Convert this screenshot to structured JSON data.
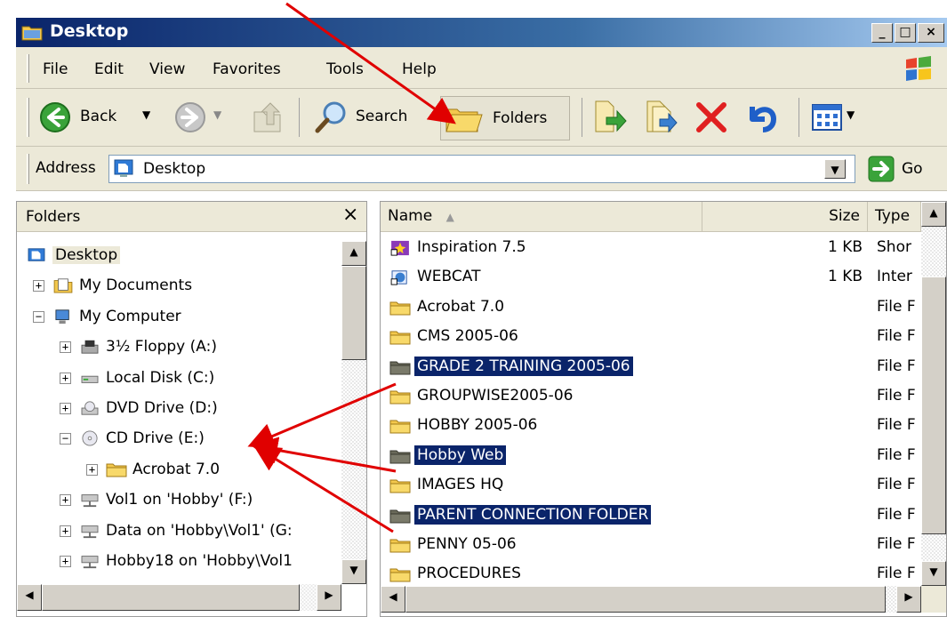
{
  "window": {
    "title": "Desktop"
  },
  "caption_buttons": {
    "minimize": "_",
    "maximize": "□",
    "close": "×"
  },
  "menu": [
    "File",
    "Edit",
    "View",
    "Favorites",
    "Tools",
    "Help"
  ],
  "toolbar": {
    "back_label": "Back",
    "search_label": "Search",
    "folders_label": "Folders"
  },
  "address": {
    "label": "Address",
    "value": "Desktop",
    "go_label": "Go"
  },
  "folders_pane": {
    "title": "Folders",
    "close_label": "×",
    "items": [
      {
        "label": "Desktop",
        "icon": "desktop-icon",
        "expander": ""
      },
      {
        "label": "My Documents",
        "icon": "my-documents-icon",
        "expander": "+"
      },
      {
        "label": "My Computer",
        "icon": "my-computer-icon",
        "expander": "−"
      },
      {
        "label": "3½ Floppy (A:)",
        "icon": "floppy-icon",
        "expander": "+"
      },
      {
        "label": "Local Disk (C:)",
        "icon": "hard-disk-icon",
        "expander": "+"
      },
      {
        "label": "DVD Drive (D:)",
        "icon": "dvd-drive-icon",
        "expander": "+"
      },
      {
        "label": "CD Drive (E:)",
        "icon": "cd-drive-icon",
        "expander": "−"
      },
      {
        "label": "Acrobat 7.0",
        "icon": "folder-icon",
        "expander": "+"
      },
      {
        "label": "Vol1 on 'Hobby' (F:)",
        "icon": "network-drive-icon",
        "expander": "+"
      },
      {
        "label": "Data on 'Hobby\\Vol1' (G:",
        "icon": "network-drive-icon",
        "expander": "+"
      },
      {
        "label": "Hobby18 on 'Hobby\\Vol1",
        "icon": "network-drive-icon",
        "expander": "+"
      }
    ]
  },
  "file_list": {
    "columns": [
      "Name",
      "Size",
      "Type"
    ],
    "rows": [
      {
        "name": "Inspiration 7.5",
        "size": "1 KB",
        "type": "Shor",
        "icon": "shortcut-app-icon",
        "selected": false
      },
      {
        "name": "WEBCAT",
        "size": "1 KB",
        "type": "Inter",
        "icon": "internet-shortcut-icon",
        "selected": false
      },
      {
        "name": "Acrobat 7.0",
        "size": "",
        "type": "File F",
        "icon": "folder-icon",
        "selected": false
      },
      {
        "name": "CMS 2005-06",
        "size": "",
        "type": "File F",
        "icon": "folder-icon",
        "selected": false
      },
      {
        "name": "GRADE 2 TRAINING 2005-06",
        "size": "",
        "type": "File F",
        "icon": "folder-icon",
        "selected": true
      },
      {
        "name": "GROUPWISE2005-06",
        "size": "",
        "type": "File F",
        "icon": "folder-icon",
        "selected": false
      },
      {
        "name": "HOBBY 2005-06",
        "size": "",
        "type": "File F",
        "icon": "folder-icon",
        "selected": false
      },
      {
        "name": "Hobby Web",
        "size": "",
        "type": "File F",
        "icon": "folder-icon",
        "selected": true
      },
      {
        "name": "IMAGES HQ",
        "size": "",
        "type": "File F",
        "icon": "folder-icon",
        "selected": false
      },
      {
        "name": "PARENT CONNECTION FOLDER",
        "size": "",
        "type": "File F",
        "icon": "folder-icon",
        "selected": true
      },
      {
        "name": "PENNY 05-06",
        "size": "",
        "type": "File F",
        "icon": "folder-icon",
        "selected": false
      },
      {
        "name": "PROCEDURES",
        "size": "",
        "type": "File F",
        "icon": "folder-icon",
        "selected": false
      }
    ]
  },
  "colors": {
    "annotation_arrow": "#e00000",
    "selection": "#0a246a",
    "titlebar": "#0a246a"
  }
}
